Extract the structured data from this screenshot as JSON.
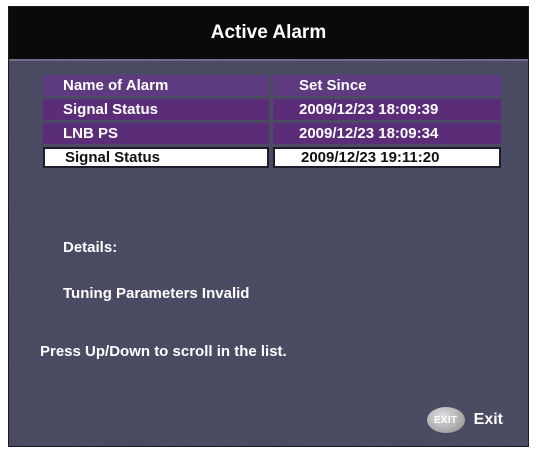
{
  "title": "Active Alarm",
  "table": {
    "headers": {
      "name": "Name of Alarm",
      "since": "Set Since"
    },
    "rows": [
      {
        "name": "Signal Status",
        "since": "2009/12/23 18:09:39"
      },
      {
        "name": "LNB PS",
        "since": "2009/12/23 18:09:34"
      },
      {
        "name": "Signal Status",
        "since": "2009/12/23 19:11:20"
      }
    ]
  },
  "details": {
    "label": "Details:",
    "text": "Tuning Parameters Invalid"
  },
  "hint": "Press Up/Down to scroll in the list.",
  "exit": {
    "icon_text": "EXIT",
    "label": "Exit"
  }
}
